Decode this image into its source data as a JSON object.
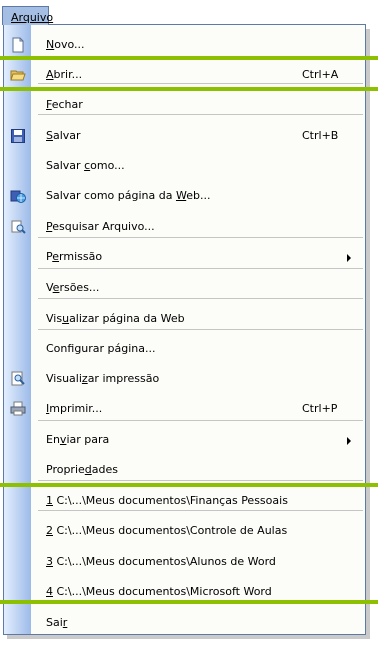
{
  "menu_title": "Arquivo",
  "menu": {
    "items": [
      {
        "pre": "",
        "u": "N",
        "post": "ovo...",
        "shortcut": "",
        "icon": "new-document-icon"
      },
      {
        "pre": "",
        "u": "A",
        "post": "brir...",
        "shortcut": "Ctrl+A",
        "icon": "open-folder-icon"
      },
      {
        "pre": "",
        "u": "F",
        "post": "echar",
        "shortcut": "",
        "icon": ""
      },
      {
        "pre": "",
        "u": "S",
        "post": "alvar",
        "shortcut": "Ctrl+B",
        "icon": "save-disk-icon"
      },
      {
        "pre": "Salvar ",
        "u": "c",
        "post": "omo...",
        "shortcut": "",
        "icon": ""
      },
      {
        "pre": "Salvar como página da ",
        "u": "W",
        "post": "eb...",
        "shortcut": "",
        "icon": "save-as-web-icon"
      },
      {
        "pre": "",
        "u": "P",
        "post": "esquisar Arquivo...",
        "shortcut": "",
        "icon": "search-file-icon"
      },
      {
        "pre": "P",
        "u": "e",
        "post": "rmissão",
        "shortcut": "",
        "icon": "",
        "submenu": true
      },
      {
        "pre": "V",
        "u": "e",
        "post": "rsões...",
        "shortcut": "",
        "icon": ""
      },
      {
        "pre": "Vis",
        "u": "u",
        "post": "alizar página da Web",
        "shortcut": "",
        "icon": ""
      },
      {
        "pre": "Conf",
        "u": "i",
        "post": "gurar página...",
        "shortcut": "",
        "icon": ""
      },
      {
        "pre": "Visuali",
        "u": "z",
        "post": "ar impressão",
        "shortcut": "",
        "icon": "print-preview-icon"
      },
      {
        "pre": "",
        "u": "I",
        "post": "mprimir...",
        "shortcut": "Ctrl+P",
        "icon": "printer-icon"
      },
      {
        "pre": "En",
        "u": "v",
        "post": "iar para",
        "shortcut": "",
        "icon": "",
        "submenu": true
      },
      {
        "pre": "Proprie",
        "u": "d",
        "post": "ades",
        "shortcut": "",
        "icon": ""
      },
      {
        "pre": "",
        "u": "1",
        "post": " C:\\...\\Meus documentos\\Finanças Pessoais",
        "shortcut": "",
        "icon": ""
      },
      {
        "pre": "",
        "u": "2",
        "post": " C:\\...\\Meus documentos\\Controle de Aulas",
        "shortcut": "",
        "icon": ""
      },
      {
        "pre": "",
        "u": "3",
        "post": " C:\\...\\Meus documentos\\Alunos de Word",
        "shortcut": "",
        "icon": ""
      },
      {
        "pre": "",
        "u": "4",
        "post": " C:\\...\\Meus documentos\\Microsoft Word",
        "shortcut": "",
        "icon": ""
      },
      {
        "pre": "Sai",
        "u": "r",
        "post": "",
        "shortcut": "",
        "icon": ""
      }
    ]
  },
  "colors": {
    "highlight_line": "#8cc000",
    "gutter_top": "#e3effe",
    "gutter_bottom": "#9dbae8",
    "menu_border": "#5f79a7"
  }
}
